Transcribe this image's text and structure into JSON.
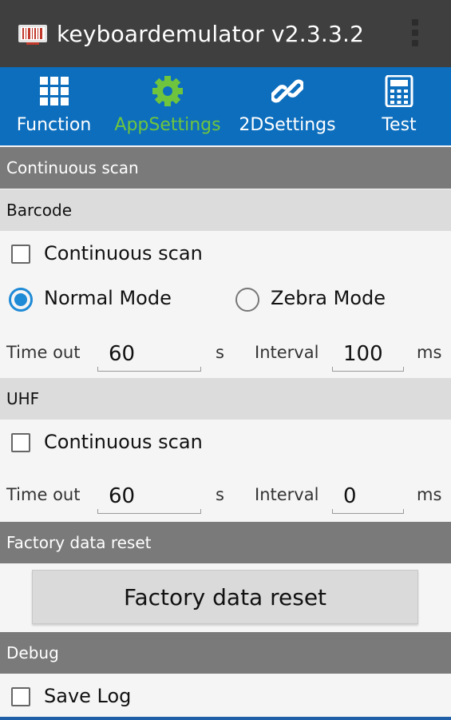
{
  "appbar": {
    "title": "keyboardemulator v2.3.3.2",
    "icon": "barcode-app-icon",
    "menu_icon": "overflow-menu-icon"
  },
  "tabs": [
    {
      "label": "Function",
      "icon": "grid-icon",
      "active": false
    },
    {
      "label": "AppSettings",
      "icon": "gear-icon",
      "active": true
    },
    {
      "label": "2DSettings",
      "icon": "link-icon",
      "active": false
    },
    {
      "label": "Test",
      "icon": "calculator-icon",
      "active": false
    }
  ],
  "sections": {
    "continuous_scan": "Continuous scan",
    "barcode": "Barcode",
    "uhf": "UHF",
    "factory_reset": "Factory data reset",
    "debug": "Debug"
  },
  "barcode": {
    "continuous_label": "Continuous scan",
    "continuous_checked": false,
    "normal_mode_label": "Normal Mode",
    "zebra_mode_label": "Zebra Mode",
    "selected_mode": "Normal Mode",
    "timeout_label": "Time out",
    "timeout_value": "60",
    "timeout_unit": "s",
    "interval_label": "Interval",
    "interval_value": "100",
    "interval_unit": "ms"
  },
  "uhf": {
    "continuous_label": "Continuous scan",
    "continuous_checked": false,
    "timeout_label": "Time out",
    "timeout_value": "60",
    "timeout_unit": "s",
    "interval_label": "Interval",
    "interval_value": "0",
    "interval_unit": "ms"
  },
  "factory": {
    "button_label": "Factory data reset"
  },
  "debug": {
    "save_log_label": "Save Log",
    "save_log_checked": false
  },
  "colors": {
    "appbar": "#3f3f3f",
    "tabbar": "#0d6ebd",
    "active_tab": "#6ec53d",
    "radio_accent": "#1f8ad6"
  }
}
